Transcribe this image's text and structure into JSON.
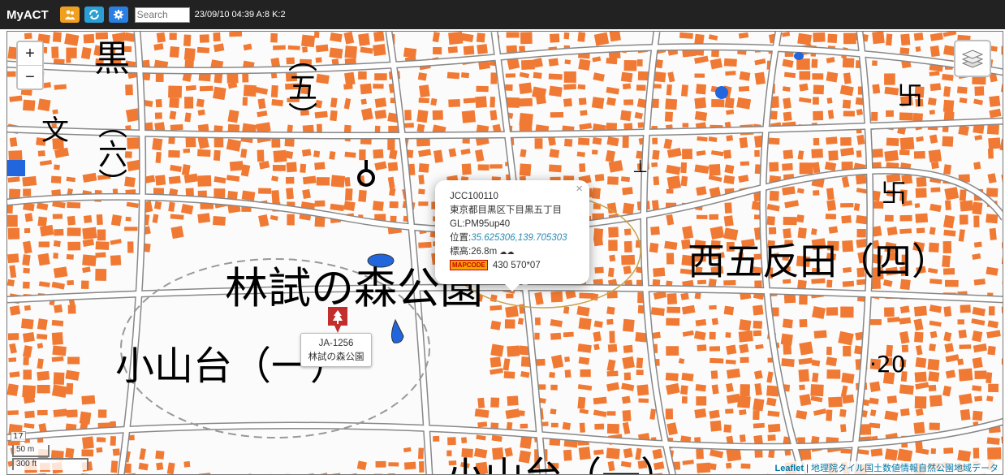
{
  "app": {
    "title": "MyACT"
  },
  "toolbar": {
    "buttons": [
      {
        "icon": "people-icon",
        "color": "#f0a020"
      },
      {
        "icon": "sync-icon",
        "color": "#2a9fd6"
      },
      {
        "icon": "gear-icon",
        "color": "#2a7fe0"
      }
    ],
    "search_placeholder": "Search",
    "status": "23/09/10 04:39 A:8 K:2"
  },
  "map": {
    "zoom_in": "+",
    "zoom_out": "−",
    "zoom_level": "17",
    "scale_metric": "50 m",
    "scale_imperial": "300 ft",
    "attribution_leaflet": "Leaflet",
    "attribution_sep": " | ",
    "attribution_source": "地理院タイル",
    "attribution_rest": "国土数値情報自然公園地域データ",
    "labels": {
      "kuro": "黒",
      "go_paren": "（五）",
      "roku_paren": "（六）",
      "park_name": "林試の森公園",
      "nishi_gotanda": "西五反田（四）",
      "koyamadai": "小山台（一）",
      "koyamadai_bottom": "小山台（一）",
      "num_20": "·20"
    },
    "marker": {
      "code": "JA-1256",
      "name": "林試の森公園"
    },
    "popup": {
      "close": "×",
      "line1": "JCC100110",
      "line2": "東京都目黒区下目黒五丁目",
      "line3": "GL:PM95up40",
      "pos_label": "位置:",
      "coords": "35.625306,139.705303",
      "elev": "標高:26.8m",
      "elev_icon": "☁☁",
      "maplogo": "MAPCODE",
      "mapcode": "430 570*07"
    }
  }
}
